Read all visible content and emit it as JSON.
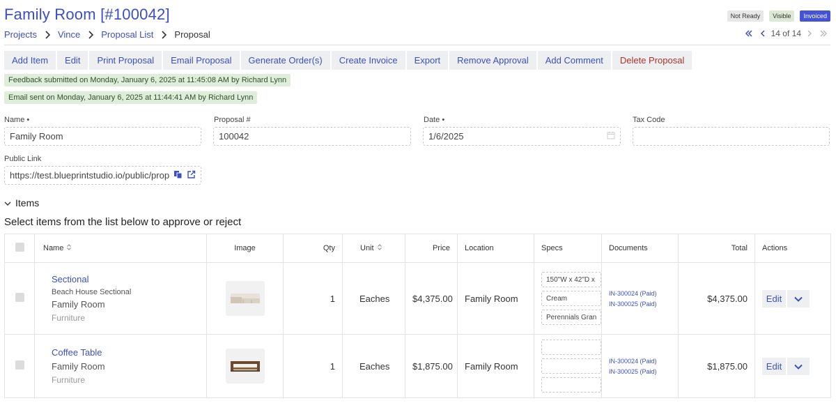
{
  "page": {
    "title": "Family Room [#100042]"
  },
  "status_badges": [
    {
      "label": "Not Ready",
      "color": "#e7e7e7"
    },
    {
      "label": "Visible",
      "color": "#dde9d6"
    },
    {
      "label": "Invoiced",
      "color": "#4453d6"
    }
  ],
  "breadcrumb": [
    "Projects",
    "Vince",
    "Proposal List",
    "Proposal"
  ],
  "pager": {
    "label": "14 of 14"
  },
  "toolbar": {
    "add_item": "Add Item",
    "edit": "Edit",
    "print_proposal": "Print Proposal",
    "email_proposal": "Email Proposal",
    "generate_orders": "Generate Order(s)",
    "create_invoice": "Create Invoice",
    "export": "Export",
    "remove_approval": "Remove Approval",
    "add_comment": "Add Comment",
    "delete_proposal": "Delete Proposal"
  },
  "notices": {
    "feedback": "Feedback submitted on Monday, January 6, 2025 at 11:45:08 AM by Richard Lynn",
    "email": "Email sent on Monday, January 6, 2025 at 11:44:41 AM by Richard Lynn"
  },
  "form": {
    "name_label": "Name",
    "name_value": "Family Room",
    "proposal_label": "Proposal #",
    "proposal_value": "100042",
    "date_label": "Date",
    "date_value": "1/6/2025",
    "tax_label": "Tax Code",
    "tax_value": "",
    "public_link_label": "Public Link",
    "public_link_value": "https://test.blueprintstudio.io/public/propo"
  },
  "items_section": {
    "toggle_label": "Items",
    "instructions": "Select items from the list below to approve or reject"
  },
  "table": {
    "headers": {
      "name": "Name",
      "image": "Image",
      "qty": "Qty",
      "unit": "Unit",
      "price": "Price",
      "location": "Location",
      "specs": "Specs",
      "documents": "Documents",
      "total": "Total",
      "actions": "Actions"
    },
    "rows": [
      {
        "name": "Sectional",
        "description": "Beach House Sectional",
        "location_sub": "Family Room",
        "category": "Furniture",
        "qty": "1",
        "unit": "Eaches",
        "price": "$4,375.00",
        "location": "Family Room",
        "specs": [
          "150\"W x 42\"D x",
          "Cream",
          "Perennials Gran"
        ],
        "documents": [
          "IN-300024 (Paid)",
          "IN-300025 (Paid)"
        ],
        "total": "$4,375.00",
        "edit_label": "Edit"
      },
      {
        "name": "Coffee Table",
        "description": "",
        "location_sub": "Family Room",
        "category": "Furniture",
        "qty": "1",
        "unit": "Eaches",
        "price": "$1,875.00",
        "location": "Family Room",
        "specs": [
          "",
          "",
          ""
        ],
        "documents": [
          "IN-300024 (Paid)",
          "IN-300025 (Paid)"
        ],
        "total": "$1,875.00",
        "edit_label": "Edit"
      }
    ]
  },
  "colors": {
    "accent": "#3b4fc4",
    "danger": "#b0302a",
    "notice_bg": "#dfeedb"
  },
  "icons": [
    "chevron-right-icon",
    "double-chevron-left-icon",
    "chevron-left-icon",
    "double-chevron-right-icon",
    "calendar-icon",
    "copy-icon",
    "external-link-icon",
    "chevron-down-icon",
    "sort-icon",
    "sofa-image",
    "coffee-table-image"
  ]
}
